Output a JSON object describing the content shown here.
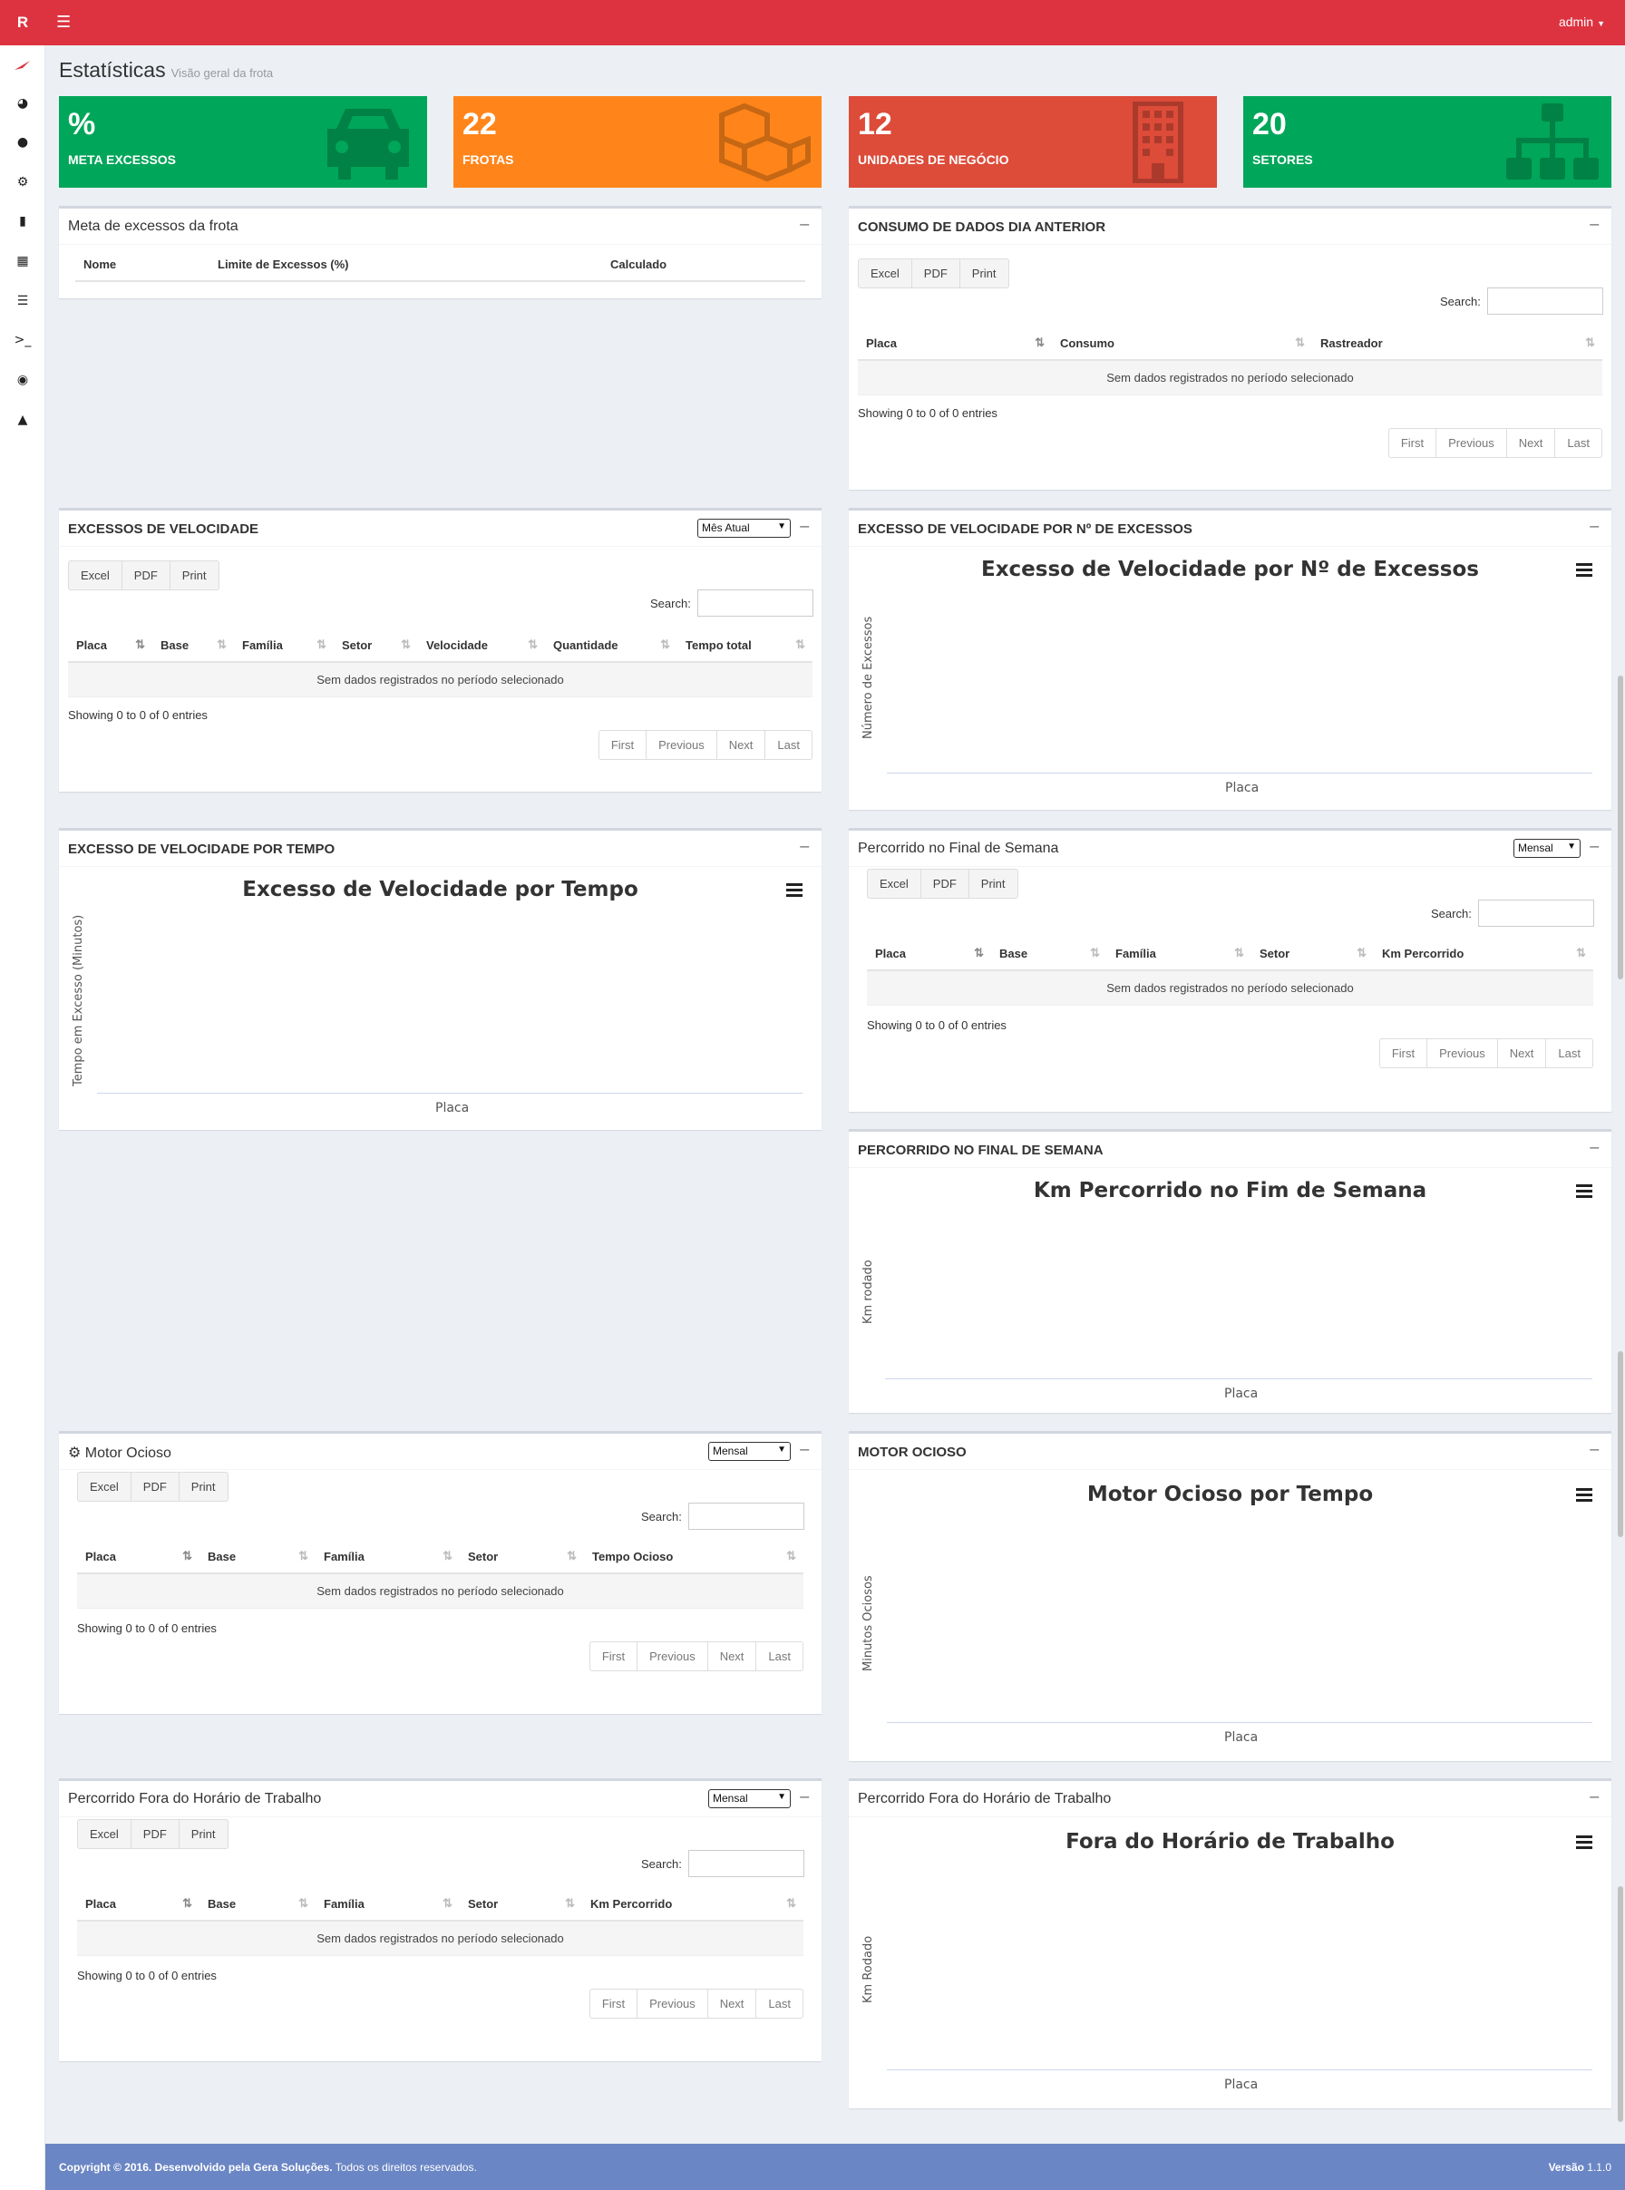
{
  "topbar": {
    "logo": "R",
    "user": "admin"
  },
  "header": {
    "title": "Estatísticas",
    "subtitle": "Visão geral da frota"
  },
  "kpis": [
    {
      "value": "%",
      "label": "META EXCESSOS",
      "color": "#00a65a",
      "icon": "car-icon"
    },
    {
      "value": "22",
      "label": "FROTAS",
      "color": "#ff851b",
      "icon": "cubes-icon"
    },
    {
      "value": "12",
      "label": "UNIDADES DE NEGÓCIO",
      "color": "#dd4b39",
      "icon": "building-icon"
    },
    {
      "value": "20",
      "label": "SETORES",
      "color": "#00a65a",
      "icon": "sitemap-icon"
    }
  ],
  "common": {
    "excel": "Excel",
    "pdf": "PDF",
    "print": "Print",
    "search": "Search:",
    "empty": "Sem dados registrados no período selecionado",
    "showing": "Showing 0 to 0 of 0 entries",
    "first": "First",
    "previous": "Previous",
    "next": "Next",
    "last": "Last",
    "minus": "−"
  },
  "meta": {
    "title": "Meta de excessos da frota",
    "cols": [
      "Nome",
      "Limite de Excessos (%)",
      "Calculado"
    ]
  },
  "consumo": {
    "title": "CONSUMO DE DADOS DIA ANTERIOR",
    "cols": [
      "Placa",
      "Consumo",
      "Rastreador"
    ]
  },
  "excessos": {
    "title": "EXCESSOS DE VELOCIDADE",
    "select": "Mês Atual",
    "cols": [
      "Placa",
      "Base",
      "Família",
      "Setor",
      "Velocidade",
      "Quantidade",
      "Tempo total"
    ]
  },
  "chart_num": {
    "title": "EXCESSO DE VELOCIDADE POR Nº DE EXCESSOS",
    "chart_title": "Excesso de Velocidade por Nº de Excessos",
    "ylabel": "Número de Excessos",
    "xlabel": "Placa"
  },
  "chart_tempo": {
    "title": "EXCESSO DE VELOCIDADE POR TEMPO",
    "chart_title": "Excesso de Velocidade por Tempo",
    "ylabel": "Tempo em Excesso (Minutos)",
    "xlabel": "Placa"
  },
  "fim_semana": {
    "title": "Percorrido no Final de Semana",
    "select": "Mensal",
    "cols": [
      "Placa",
      "Base",
      "Família",
      "Setor",
      "Km Percorrido"
    ]
  },
  "chart_fim": {
    "title": "PERCORRIDO NO FINAL DE SEMANA",
    "chart_title": "Km Percorrido no Fim de Semana",
    "ylabel": "Km rodado",
    "xlabel": "Placa"
  },
  "motor": {
    "title": "Motor Ocioso",
    "select": "Mensal",
    "cols": [
      "Placa",
      "Base",
      "Família",
      "Setor",
      "Tempo Ocioso"
    ]
  },
  "chart_motor": {
    "title": "MOTOR OCIOSO",
    "chart_title": "Motor Ocioso por Tempo",
    "ylabel": "Minutos Ociosos",
    "xlabel": "Placa"
  },
  "fora": {
    "title": "Percorrido Fora do Horário de Trabalho",
    "select": "Mensal",
    "cols": [
      "Placa",
      "Base",
      "Família",
      "Setor",
      "Km Percorrido"
    ]
  },
  "chart_fora": {
    "title": "Percorrido Fora do Horário de Trabalho",
    "chart_title": "Fora do Horário de Trabalho",
    "ylabel": "Km Rodado",
    "xlabel": "Placa"
  },
  "footer": {
    "copyright": "Copyright © 2016. Desenvolvido pela Gera Soluções.",
    "rights": "Todos os direitos reservados.",
    "version_label": "Versão",
    "version": "1.1.0"
  }
}
